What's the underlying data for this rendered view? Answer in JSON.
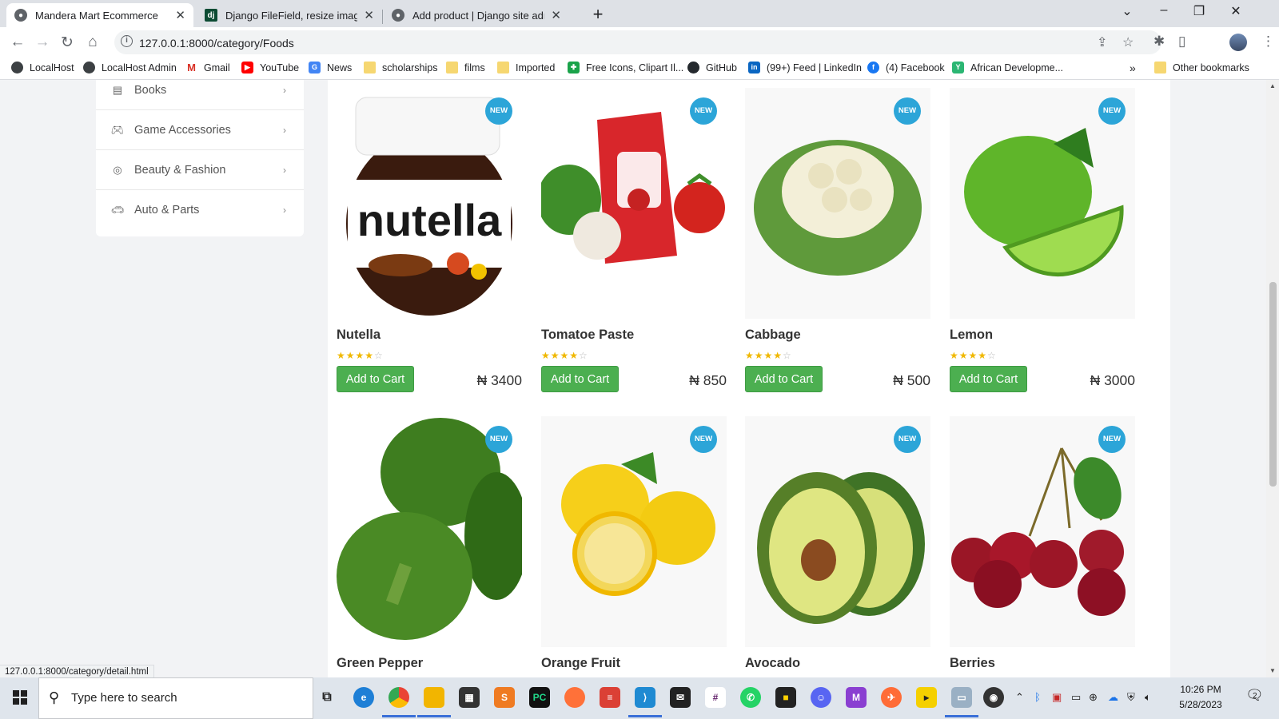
{
  "browser": {
    "tabs": [
      {
        "title": "Mandera Mart Ecommerce",
        "active": true
      },
      {
        "title": "Django FileField, resize image be",
        "active": false
      },
      {
        "title": "Add product | Django site admin",
        "active": false
      }
    ],
    "url": "127.0.0.1:8000/category/Foods",
    "bookmarks": [
      {
        "label": "LocalHost",
        "icon": "globe-icon"
      },
      {
        "label": "LocalHost Admin",
        "icon": "globe-icon"
      },
      {
        "label": "Gmail",
        "icon": "gmail-icon"
      },
      {
        "label": "YouTube",
        "icon": "youtube-icon"
      },
      {
        "label": "News",
        "icon": "news-icon"
      },
      {
        "label": "scholarships",
        "icon": "folder-icon"
      },
      {
        "label": "films",
        "icon": "folder-icon"
      },
      {
        "label": "Imported",
        "icon": "folder-icon"
      },
      {
        "label": "Free Icons, Clipart Il...",
        "icon": "icons-site-icon"
      },
      {
        "label": "GitHub",
        "icon": "github-icon"
      },
      {
        "label": "(99+) Feed | LinkedIn",
        "icon": "linkedin-icon"
      },
      {
        "label": "(4) Facebook",
        "icon": "facebook-icon"
      },
      {
        "label": "African Developme...",
        "icon": "afdb-icon"
      }
    ],
    "more_bookmarks": "»",
    "other_bookmarks": "Other bookmarks",
    "status_url": "127.0.0.1:8000/category/detail.html"
  },
  "sidebar": {
    "categories": [
      {
        "label": "Books",
        "icon": "book-icon"
      },
      {
        "label": "Game Accessories",
        "icon": "gamepad-icon"
      },
      {
        "label": "Beauty & Fashion",
        "icon": "target-icon"
      },
      {
        "label": "Auto & Parts",
        "icon": "car-icon"
      }
    ]
  },
  "products": {
    "badge": "NEW",
    "add_to_cart_label": "Add to Cart",
    "rating_max": 5,
    "items": [
      {
        "name": "Nutella",
        "price": "₦ 3400",
        "rating": 4
      },
      {
        "name": "Tomatoe Paste",
        "price": "₦ 850",
        "rating": 4
      },
      {
        "name": "Cabbage",
        "price": "₦ 500",
        "rating": 4
      },
      {
        "name": "Lemon",
        "price": "₦ 3000",
        "rating": 4
      },
      {
        "name": "Green Pepper",
        "price": "",
        "rating": 4
      },
      {
        "name": "Orange Fruit",
        "price": "",
        "rating": 4
      },
      {
        "name": "Avocado",
        "price": "",
        "rating": 4
      },
      {
        "name": "Berries",
        "price": "",
        "rating": 4
      }
    ]
  },
  "taskbar": {
    "search_placeholder": "Type here to search",
    "time": "10:26 PM",
    "date": "5/28/2023",
    "notification_count": "2"
  },
  "colors": {
    "accent_green": "#4caf50",
    "badge_blue": "#2ca5d8",
    "star": "#f0b800"
  }
}
